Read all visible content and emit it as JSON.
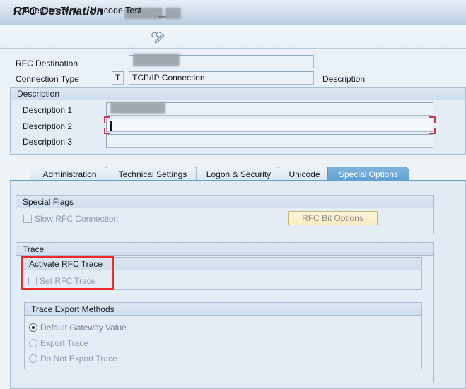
{
  "window": {
    "title": "RFC Destination",
    "title_redacted": true
  },
  "toolbar": {
    "connection_test": "Connection Test",
    "unicode_test": "Unicode Test",
    "edit_icon_name": "glasses-pencil-icon"
  },
  "header_form": {
    "rfc_destination_label": "RFC Destination",
    "rfc_destination_value": "",
    "rfc_destination_redacted": true,
    "connection_type_label": "Connection Type",
    "connection_type_code": "T",
    "connection_type_text": "TCP/IP Connection",
    "description_label": "Description"
  },
  "description_group": {
    "title": "Description",
    "rows": [
      {
        "label": "Description 1",
        "value": "",
        "redacted": true,
        "focused": false
      },
      {
        "label": "Description 2",
        "value": "",
        "redacted": false,
        "focused": true
      },
      {
        "label": "Description 3",
        "value": "",
        "redacted": false,
        "focused": false
      }
    ]
  },
  "tabs": [
    {
      "label": "Administration",
      "active": false
    },
    {
      "label": "Technical Settings",
      "active": false
    },
    {
      "label": "Logon & Security",
      "active": false
    },
    {
      "label": "Unicode",
      "active": false
    },
    {
      "label": "Special Options",
      "active": true
    }
  ],
  "special_flags": {
    "title": "Special Flags",
    "slow_rfc_connection": {
      "label": "Slow RFC Connection",
      "checked": false,
      "enabled": false
    },
    "rfc_bit_options_button": "RFC Bit Options"
  },
  "trace": {
    "title": "Trace",
    "activate_group": {
      "title": "Activate RFC Trace",
      "set_rfc_trace": {
        "label": "Set RFC Trace",
        "checked": false,
        "enabled": false
      },
      "highlighted": true
    },
    "export_group": {
      "title": "Trace Export Methods",
      "options": [
        {
          "label": "Default Gateway Value",
          "selected": true
        },
        {
          "label": "Export Trace",
          "selected": false
        },
        {
          "label": "Do Not Export Trace",
          "selected": false
        }
      ]
    }
  },
  "colors": {
    "title_bar_start": "#e8f0f7",
    "title_bar_end": "#b9cde0",
    "panel_bg": "#e2eaf4",
    "group_bg": "#e4ecf5",
    "group_border": "#aabdd0",
    "active_tab": "#5fa0d2",
    "button_yellow": "#f8edc2",
    "button_yellow_border": "#c9b272",
    "annotation_red": "#ef2a2a",
    "focus_red": "#d0394b",
    "disabled_text": "#8b9bab"
  }
}
